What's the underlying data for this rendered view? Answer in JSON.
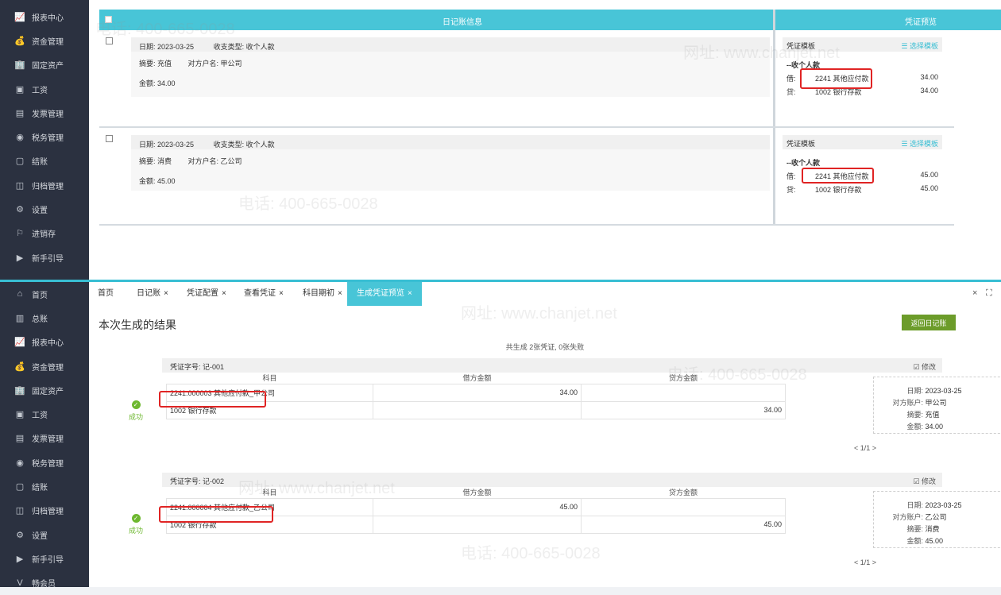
{
  "sidebar_top": [
    {
      "icon": "chart-icon",
      "glyph": "📈",
      "label": "报表中心"
    },
    {
      "icon": "money-icon",
      "glyph": "💰",
      "label": "资金管理"
    },
    {
      "icon": "building-icon",
      "glyph": "🏢",
      "label": "固定资产"
    },
    {
      "icon": "salary-icon",
      "glyph": "▣",
      "label": "工资"
    },
    {
      "icon": "invoice-icon",
      "glyph": "▤",
      "label": "发票管理"
    },
    {
      "icon": "tax-icon",
      "glyph": "◉",
      "label": "税务管理"
    },
    {
      "icon": "close-book-icon",
      "glyph": "▢",
      "label": "结账"
    },
    {
      "icon": "archive-icon",
      "glyph": "◫",
      "label": "归档管理"
    },
    {
      "icon": "gear-icon",
      "glyph": "⚙",
      "label": "设置"
    },
    {
      "icon": "inventory-icon",
      "glyph": "⚐",
      "label": "进销存"
    },
    {
      "icon": "guide-icon",
      "glyph": "▶",
      "label": "新手引导"
    }
  ],
  "sidebar_bottom": [
    {
      "icon": "home-icon",
      "glyph": "⌂",
      "label": "首页"
    },
    {
      "icon": "ledger-icon",
      "glyph": "▥",
      "label": "总账"
    },
    {
      "icon": "chart-icon",
      "glyph": "📈",
      "label": "报表中心"
    },
    {
      "icon": "money-icon",
      "glyph": "💰",
      "label": "资金管理"
    },
    {
      "icon": "building-icon",
      "glyph": "🏢",
      "label": "固定资产"
    },
    {
      "icon": "salary-icon",
      "glyph": "▣",
      "label": "工资"
    },
    {
      "icon": "invoice-icon",
      "glyph": "▤",
      "label": "发票管理"
    },
    {
      "icon": "tax-icon",
      "glyph": "◉",
      "label": "税务管理"
    },
    {
      "icon": "close-book-icon",
      "glyph": "▢",
      "label": "结账"
    },
    {
      "icon": "archive-icon",
      "glyph": "◫",
      "label": "归档管理"
    },
    {
      "icon": "gear-icon",
      "glyph": "⚙",
      "label": "设置"
    },
    {
      "icon": "guide-icon",
      "glyph": "▶",
      "label": "新手引导"
    },
    {
      "icon": "vip-icon",
      "glyph": "V",
      "label": "畅会员"
    }
  ],
  "top_panel": {
    "header_journal": "日记账信息",
    "header_preview": "凭证预览",
    "records": [
      {
        "date": "日期: 2023-03-25",
        "type": "收支类型: 收个人款",
        "summary": "摘要: 充值",
        "counterparty": "对方户名: 甲公司",
        "amount": "金额: 34.00",
        "template": "凭证模板",
        "select": "选择模板",
        "vtitle": "--收个人款",
        "debit_label": "借:",
        "debit_account": "2241 其他应付款",
        "debit_amount": "34.00",
        "credit_label": "贷:",
        "credit_account": "1002 银行存款",
        "credit_amount": "34.00"
      },
      {
        "date": "日期: 2023-03-25",
        "type": "收支类型: 收个人款",
        "summary": "摘要: 消费",
        "counterparty": "对方户名: 乙公司",
        "amount": "金额: 45.00",
        "template": "凭证模板",
        "select": "选择模板",
        "vtitle": "--收个人款",
        "debit_label": "借:",
        "debit_account": "2241 其他应付款",
        "debit_amount": "45.00",
        "credit_label": "贷:",
        "credit_account": "1002 银行存款",
        "credit_amount": "45.00"
      }
    ]
  },
  "tabs": [
    {
      "label": "首页",
      "closable": ""
    },
    {
      "label": "日记账",
      "closable": "×"
    },
    {
      "label": "凭证配置",
      "closable": "×"
    },
    {
      "label": "查看凭证",
      "closable": "×"
    },
    {
      "label": "科目期初",
      "closable": "×"
    },
    {
      "label": "生成凭证预览",
      "closable": "×"
    }
  ],
  "window_controls": {
    "close": "×",
    "expand": "⛶"
  },
  "result": {
    "title": "本次生成的结果",
    "back_button": "返回日记账",
    "summary": "共生成 2张凭证, 0张失败",
    "columns": [
      "科目",
      "借方金额",
      "贷方金额"
    ],
    "vouchers": [
      {
        "number": "凭证字号: 记-001",
        "edit": "☑ 修改",
        "status": "成功",
        "lines": [
          {
            "account": "2241.000003 其他应付款_甲公司",
            "debit": "34.00",
            "credit": ""
          },
          {
            "account": "1002 银行存款",
            "debit": "",
            "credit": "34.00"
          }
        ],
        "info": {
          "date_k": "日期:",
          "date_v": "2023-03-25",
          "acct_k": "对方账户:",
          "acct_v": "甲公司",
          "sum_k": "摘要:",
          "sum_v": "充值",
          "amt_k": "金额:",
          "amt_v": "34.00"
        },
        "pager": "< 1/1 >"
      },
      {
        "number": "凭证字号: 记-002",
        "edit": "☑ 修改",
        "status": "成功",
        "lines": [
          {
            "account": "2241.000004 其他应付款_乙公司",
            "debit": "45.00",
            "credit": ""
          },
          {
            "account": "1002 银行存款",
            "debit": "",
            "credit": "45.00"
          }
        ],
        "info": {
          "date_k": "日期:",
          "date_v": "2023-03-25",
          "acct_k": "对方账户:",
          "acct_v": "乙公司",
          "sum_k": "摘要:",
          "sum_v": "消费",
          "amt_k": "金额:",
          "amt_v": "45.00"
        },
        "pager": "< 1/1 >"
      }
    ]
  },
  "watermark": {
    "phone": "电话: 400-665-0028",
    "site": "网址: www.chanjet.net"
  },
  "colors": {
    "accent": "#48c5d7",
    "sidebar": "#2b3140",
    "success": "#6eb830",
    "button": "#6c9c2a",
    "highlight": "#e02424"
  }
}
